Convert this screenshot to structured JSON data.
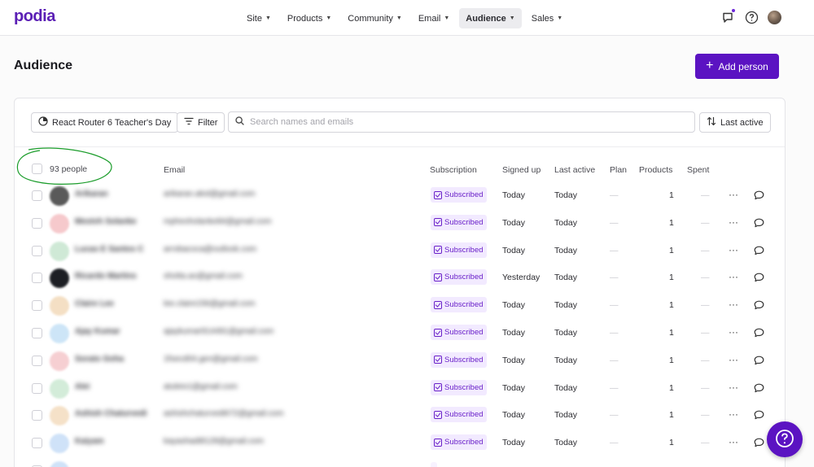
{
  "brand": {
    "logo": "podia",
    "accent": "#5b13c2"
  },
  "nav": {
    "items": [
      {
        "label": "Site"
      },
      {
        "label": "Products"
      },
      {
        "label": "Community"
      },
      {
        "label": "Email"
      },
      {
        "label": "Audience",
        "active": true
      },
      {
        "label": "Sales"
      }
    ]
  },
  "page": {
    "title": "Audience",
    "add_person_label": "Add person"
  },
  "toolbar": {
    "segment_label": "React Router 6 Teacher's Day",
    "filter_label": "Filter",
    "search_placeholder": "Search names and emails",
    "sort_label": "Last active"
  },
  "table": {
    "people_count": "93 people",
    "columns": [
      "Email",
      "Subscription",
      "Signed up",
      "Last active",
      "Plan",
      "Products",
      "Spent"
    ],
    "rows": [
      {
        "name": "Arikaran",
        "email": "arikaran.aksl@gmail.com",
        "subscription": "Subscribed",
        "signed_up": "Today",
        "last_active": "Today",
        "plan": "—",
        "products": "1",
        "spent": "—",
        "avatar_color": "#5a5a5a"
      },
      {
        "name": "Mestvh Solanke",
        "email": "mpheoholanke84@gmail.com",
        "subscription": "Subscribed",
        "signed_up": "Today",
        "last_active": "Today",
        "plan": "—",
        "products": "1",
        "spent": "—",
        "avatar_color": "#f6c9cc"
      },
      {
        "name": "Lucas E Santos C",
        "email": "arrobacoca@outlook.com",
        "subscription": "Subscribed",
        "signed_up": "Today",
        "last_active": "Today",
        "plan": "—",
        "products": "1",
        "spent": "—",
        "avatar_color": "#cfe9d6"
      },
      {
        "name": "Ricardo Martins",
        "email": "shotta.ao@gmail.com",
        "subscription": "Subscribed",
        "signed_up": "Yesterday",
        "last_active": "Today",
        "plan": "—",
        "products": "1",
        "spent": "—",
        "avatar_color": "#1d1f24"
      },
      {
        "name": "Claire Lee",
        "email": "lee.claire156@gmail.com",
        "subscription": "Subscribed",
        "signed_up": "Today",
        "last_active": "Today",
        "plan": "—",
        "products": "1",
        "spent": "—",
        "avatar_color": "#f4dfc4"
      },
      {
        "name": "Ajay Kumar",
        "email": "ajaykumar914491@gmail.com",
        "subscription": "Subscribed",
        "signed_up": "Today",
        "last_active": "Today",
        "plan": "—",
        "products": "1",
        "spent": "—",
        "avatar_color": "#cde5f7"
      },
      {
        "name": "Sorato Goha",
        "email": "1fsecd04.gen@gmail.com",
        "subscription": "Subscribed",
        "signed_up": "Today",
        "last_active": "Today",
        "plan": "—",
        "products": "1",
        "spent": "—",
        "avatar_color": "#f6cfd2"
      },
      {
        "name": "Alei",
        "email": "atuleio1@gmail.com",
        "subscription": "Subscribed",
        "signed_up": "Today",
        "last_active": "Today",
        "plan": "—",
        "products": "1",
        "spent": "—",
        "avatar_color": "#d3ecd9"
      },
      {
        "name": "Ashish Chaturvedi",
        "email": "ashishchaturvedi672@gmail.com",
        "subscription": "Subscribed",
        "signed_up": "Today",
        "last_active": "Today",
        "plan": "—",
        "products": "1",
        "spent": "—",
        "avatar_color": "#f5e1c8"
      },
      {
        "name": "Kaiyam",
        "email": "kayashadi8128@gmail.com",
        "subscription": "Subscribed",
        "signed_up": "Today",
        "last_active": "Today",
        "plan": "—",
        "products": "1",
        "spent": "—",
        "avatar_color": "#cfe2f8"
      },
      {
        "name": "",
        "email": "",
        "subscription": "",
        "signed_up": "",
        "last_active": "",
        "plan": "",
        "products": "",
        "spent": "",
        "avatar_color": "#cfe2f8"
      }
    ]
  },
  "icons": {
    "notifications": "chat-notification-icon",
    "help": "question-circle-icon",
    "row_more": "ellipsis-icon",
    "row_message": "message-bubble-icon"
  },
  "annotation_color": "#1a9c2a"
}
